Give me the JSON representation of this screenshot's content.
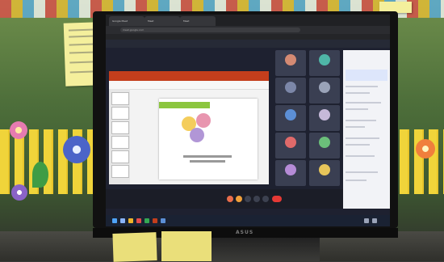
{
  "scene": {
    "description_tags": [
      "classroom-wall",
      "monitor",
      "video-meeting"
    ],
    "monitor_brand": "ASUS"
  },
  "browser": {
    "tabs": [
      {
        "label": "Google Meet"
      },
      {
        "label": "Meet"
      },
      {
        "label": "Meet"
      }
    ],
    "url": "meet.google.com"
  },
  "meeting": {
    "title": "",
    "participants_count": 12,
    "participants": [
      {
        "name": ""
      },
      {
        "name": ""
      },
      {
        "name": ""
      },
      {
        "name": ""
      },
      {
        "name": ""
      },
      {
        "name": ""
      },
      {
        "name": ""
      },
      {
        "name": ""
      },
      {
        "name": ""
      },
      {
        "name": ""
      },
      {
        "name": ""
      },
      {
        "name": ""
      }
    ]
  },
  "slide": {
    "title": ""
  },
  "colors": {
    "meet_bg": "#1e2130",
    "ppt_red": "#c43e1c",
    "end_call": "#e53935",
    "slide_green": "#8cc63f"
  }
}
